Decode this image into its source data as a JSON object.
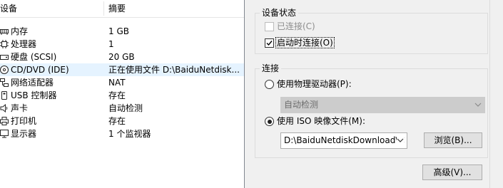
{
  "device_list": {
    "header": {
      "device": "设备",
      "summary": "摘要"
    },
    "rows": [
      {
        "name": "内存",
        "summary": "1 GB",
        "icon": "memory-icon"
      },
      {
        "name": "处理器",
        "summary": "1",
        "icon": "processor-icon"
      },
      {
        "name": "硬盘 (SCSI)",
        "summary": "20 GB",
        "icon": "hard-disk-icon"
      },
      {
        "name": "CD/DVD (IDE)",
        "summary": "正在使用文件 D:\\BaiduNetdisk...",
        "icon": "cd-dvd-icon",
        "selected": true
      },
      {
        "name": "网络适配器",
        "summary": "NAT",
        "icon": "network-adapter-icon"
      },
      {
        "name": "USB 控制器",
        "summary": "存在",
        "icon": "usb-icon"
      },
      {
        "name": "声卡",
        "summary": "自动检测",
        "icon": "sound-card-icon"
      },
      {
        "name": "打印机",
        "summary": "存在",
        "icon": "printer-icon"
      },
      {
        "name": "显示器",
        "summary": "1 个监视器",
        "icon": "display-icon"
      }
    ]
  },
  "device_status": {
    "title": "设备状态",
    "connected": {
      "label": "已连接(C)",
      "checked": false,
      "disabled": true
    },
    "connect_at_power_on": {
      "label": "启动时连接(O)",
      "checked": true
    }
  },
  "connection": {
    "title": "连接",
    "physical_drive": {
      "label": "使用物理驱动器(P):",
      "selected": false,
      "dropdown_value": "自动检测"
    },
    "iso_image": {
      "label": "使用 ISO 映像文件(M):",
      "selected": true,
      "path_value": "D:\\BaiduNetdiskDownload\\C"
    },
    "browse_button": "浏览(B)..."
  },
  "advanced_button": "高级(V)...",
  "colors": {
    "selected_row": "#e5f3ff",
    "disabled_dropdown": "#cccccc",
    "button_face": "#e1e1e1"
  }
}
